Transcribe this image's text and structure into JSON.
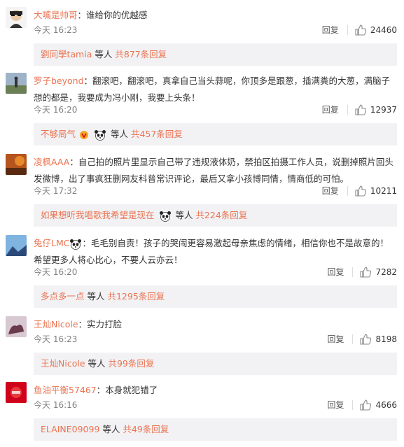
{
  "comments": [
    {
      "user": "大嘴是帅哥",
      "sep": "：",
      "text": "谁给你的优越感",
      "time": "今天 16:23",
      "reply": "回复",
      "likes": "24460",
      "sub_user": "劉同學tamia",
      "sub_mid": " 等人 ",
      "sub_total": "共877条回复"
    },
    {
      "user": "罗子beyond",
      "sep": "：",
      "text": "翻滚吧，翻滚吧，真拿自己当头蒜呢，你顶多是跟葱，插满粪的大葱，满脑子想的都是，我要成为冯小刚，我要上头条！",
      "time": "今天 16:20",
      "reply": "回复",
      "likes": "12937",
      "sub_user": "不够局气",
      "sub_mid": " 等人 ",
      "sub_total": "共457条回复"
    },
    {
      "user": "凌枫AAA",
      "sep": "：",
      "text": "自己拍的照片里显示自己带了违规液体奶，禁拍区拍摄工作人员，说删掉照片回头发微博，出了事疯狂删网友科普常识评论，最后又拿小孩博同情，情商低的可怕。",
      "time": "今天 17:32",
      "reply": "回复",
      "likes": "10211",
      "sub_user": "如果想听我唱歌我希望是现在",
      "sub_mid": " 等人 ",
      "sub_total": "共224条回复"
    },
    {
      "user": "兔仔LMC",
      "sep": "：",
      "text": "毛毛别自责！孩子的哭闹更容易激起母亲焦虑的情绪，相信你也不是故意的！希望更多人将心比心，不要人云亦云！",
      "time": "今天 16:20",
      "reply": "回复",
      "likes": "7282",
      "sub_user": "多点多一点",
      "sub_mid": " 等人 ",
      "sub_total": "共1295条回复"
    },
    {
      "user": "王灿Nicole",
      "sep": "：",
      "text": "实力打脸",
      "time": "今天 16:23",
      "reply": "回复",
      "likes": "8198",
      "sub_user": "王灿Nicole",
      "sub_mid": " 等人 ",
      "sub_total": "共99条回复"
    },
    {
      "user": "鱼油平衡57467",
      "sep": "：",
      "text": "本身就犯错了",
      "time": "今天 16:16",
      "reply": "回复",
      "likes": "4666",
      "sub_user": "ELAINE09099",
      "sub_mid": " 等人 ",
      "sub_total": "共49条回复"
    }
  ],
  "icons": {
    "like": "thumbs-up-icon",
    "panda": "panda-emoji-icon",
    "badge": "vip-badge-icon"
  },
  "colors": {
    "accent": "#eb7350",
    "subbar_bg": "#f2f2f5",
    "meta": "#808080"
  }
}
